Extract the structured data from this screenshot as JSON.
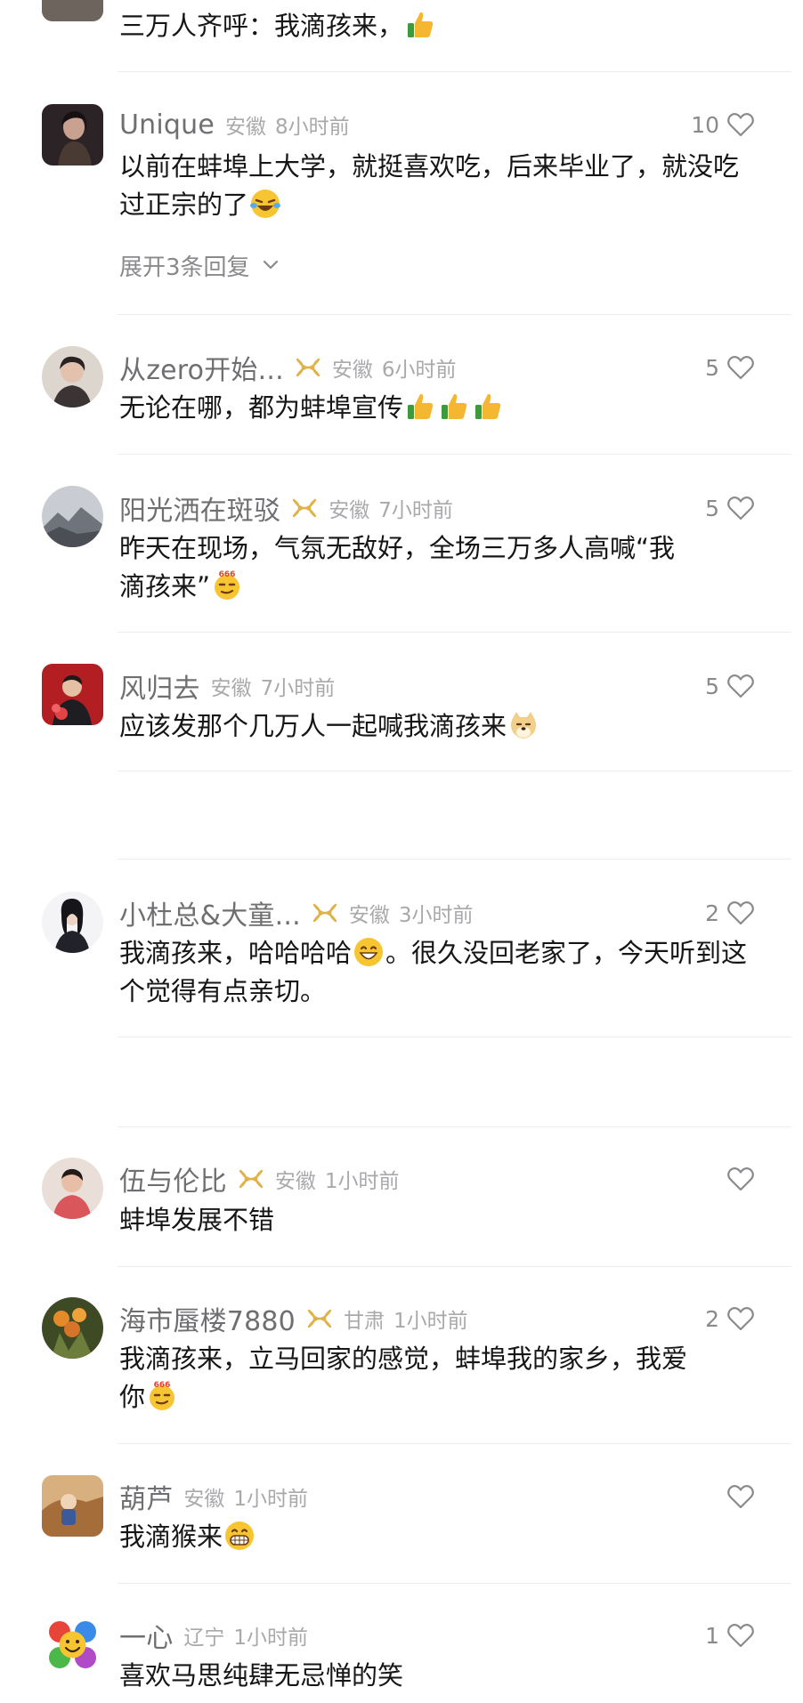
{
  "top_comment": {
    "text": "三万人齐呼：我滴孩来，"
  },
  "comments": [
    {
      "username": "Unique",
      "location": "安徽",
      "time": "8小时前",
      "likes": "10",
      "text": "以前在蚌埠上大学，就挺喜欢吃，后来毕业了，就没吃过正宗的了",
      "expand_label": "展开3条回复",
      "avatar_color": "#4a3a34"
    },
    {
      "username": "从zero开始...",
      "location": "安徽",
      "time": "6小时前",
      "likes": "5",
      "text": "无论在哪，都为蚌埠宣传",
      "avatar_color": "#8c8078"
    },
    {
      "username": "阳光洒在斑驳",
      "location": "安徽",
      "time": "7小时前",
      "likes": "5",
      "text_line1": "昨天在现场，气氛无敌好，全场三万多人高喊“我",
      "text_line2": "滴孩来”",
      "avatar_color": "#b8bcc4"
    },
    {
      "username": "风归去",
      "location": "安徽",
      "time": "7小时前",
      "likes": "5",
      "text": "应该发那个几万人一起喊我滴孩来",
      "avatar_color": "#b31e22"
    },
    {
      "username": "小杜总&大童...",
      "location": "安徽",
      "time": "3小时前",
      "likes": "2",
      "text_a": "我滴孩来，哈哈哈哈",
      "text_b": "。很久没回老家了，今天听到这个觉得有点亲切。",
      "avatar_color": "#2a2a30"
    },
    {
      "username": "伍与伦比",
      "location": "安徽",
      "time": "1小时前",
      "likes": "",
      "text": "蚌埠发展不错",
      "avatar_color": "#d98a80"
    },
    {
      "username": "海市蜃楼7880",
      "location": "甘肃",
      "time": "1小时前",
      "likes": "2",
      "text_line1": "我滴孩来，立马回家的感觉，蚌埠我的家乡，我爱",
      "text_line2": "你",
      "avatar_color": "#5e6e3a"
    },
    {
      "username": "葫芦",
      "location": "安徽",
      "time": "1小时前",
      "likes": "",
      "text": "我滴猴来",
      "avatar_color": "#b07a48"
    },
    {
      "username": "一心",
      "location": "辽宁",
      "time": "1小时前",
      "likes": "1",
      "text": "喜欢马思纯肆无忌惮的笑",
      "avatar_color": "#f2c94c"
    }
  ],
  "colors": {
    "username": "#6f6f73",
    "meta": "#a9a9ad",
    "badge": "#e0b24a",
    "divider": "#ececec",
    "text": "#161616"
  },
  "icons": {
    "like": "heart-outline-icon",
    "badge": "gold-fan-badge-icon",
    "expand": "chevron-down-icon"
  }
}
